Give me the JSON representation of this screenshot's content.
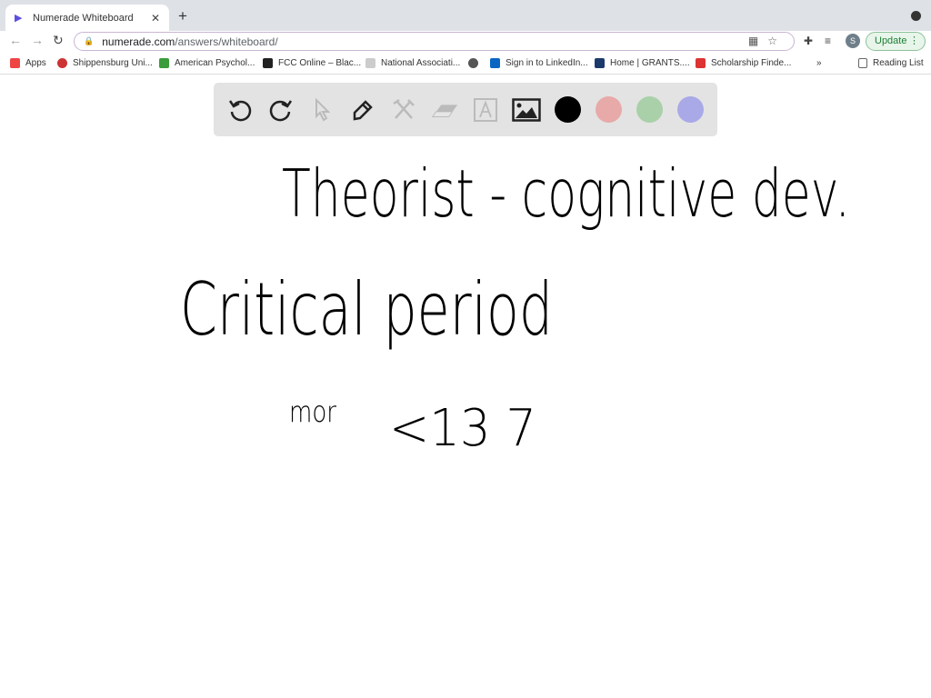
{
  "browser": {
    "tab_title": "Numerade Whiteboard",
    "url_domain": "numerade.com",
    "url_path": "/answers/whiteboard/",
    "profile_initial": "S",
    "update_label": "Update",
    "bookmarks": [
      {
        "label": "Apps",
        "icon": "apps-grid-icon",
        "color": "#e44"
      },
      {
        "label": "Shippensburg Uni...",
        "icon": "ship-logo-icon",
        "color": "#c33"
      },
      {
        "label": "American Psychol...",
        "icon": "apa-logo-icon",
        "color": "#3a9c3a"
      },
      {
        "label": "FCC Online – Blac...",
        "icon": "fcc-logo-icon",
        "color": "#222"
      },
      {
        "label": "National Associati...",
        "icon": "nasw-logo-icon",
        "color": "#ccc"
      },
      {
        "label": "",
        "icon": "globe-icon",
        "color": "#555"
      },
      {
        "label": "Sign in to LinkedIn...",
        "icon": "linkedin-icon",
        "color": "#0a66c2"
      },
      {
        "label": "Home | GRANTS....",
        "icon": "grants-logo-icon",
        "color": "#1b3a6b"
      },
      {
        "label": "Scholarship Finde...",
        "icon": "scholarship-logo-icon",
        "color": "#d33"
      }
    ],
    "overflow": "»",
    "reading_list": "Reading List"
  },
  "toolbar": {
    "tools": [
      "undo-icon",
      "redo-icon",
      "select-icon",
      "pen-icon",
      "tools-icon",
      "eraser-icon",
      "text-icon",
      "image-icon"
    ],
    "colors": [
      "#000000",
      "#e8a9a9",
      "#a9d0a9",
      "#a9a9e8"
    ]
  },
  "canvas": {
    "line1": "Theorist - cognitive dev.",
    "line2": "Critical period",
    "note": "mor",
    "line3": "<13 7"
  }
}
